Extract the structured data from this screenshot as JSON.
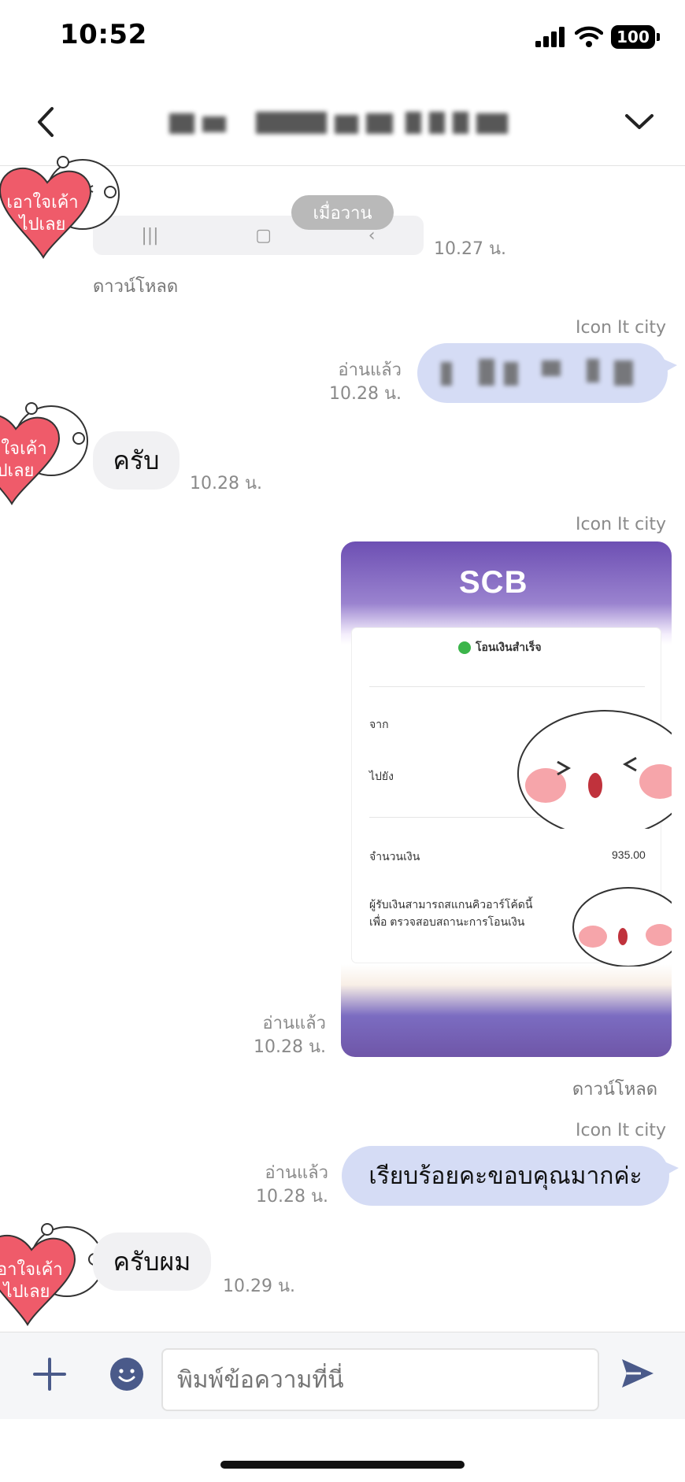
{
  "status_bar": {
    "time": "10:52",
    "battery": "100",
    "signal_icon": "signal-bars-icon",
    "wifi_icon": "wifi-icon"
  },
  "header": {
    "back_icon": "chevron-left-icon",
    "menu_icon": "chevron-down-icon"
  },
  "date_separator": "เมื่อวาน",
  "messages": [
    {
      "id": "m1",
      "direction": "in",
      "type": "sticker",
      "sticker_text": "เอาใจเค้าไปเลย",
      "time": "10.27 น.",
      "download_label": "ดาวน์โหลด"
    },
    {
      "id": "m2",
      "direction": "out",
      "sender": "Icon It city",
      "read": "อ่านแล้ว",
      "time": "10.28 น."
    },
    {
      "id": "m3",
      "direction": "in",
      "text": "ครับ",
      "time": "10.28 น."
    },
    {
      "id": "m4",
      "direction": "out",
      "sender": "Icon It city",
      "type": "image",
      "read": "อ่านแล้ว",
      "time": "10.28 น.",
      "download_label": "ดาวน์โหลด",
      "slip": {
        "bank": "SCB",
        "status": "โอนเงินสำเร็จ",
        "from_label": "จาก",
        "to_label": "ไปยัง",
        "amount_label": "จำนวนเงิน",
        "amount": "935.00",
        "note": "ผู้รับเงินสามารถสแกนคิวอาร์โค้ดนี้เพื่อ ตรวจสอบสถานะการโอนเงิน"
      }
    },
    {
      "id": "m5",
      "direction": "out",
      "sender": "Icon It city",
      "text": "เรียบร้อยคะขอบคุณมากค่ะ",
      "read": "อ่านแล้ว",
      "time": "10.28 น."
    },
    {
      "id": "m6",
      "direction": "in",
      "text": "ครับผม",
      "time": "10.29 น."
    }
  ],
  "input_bar": {
    "placeholder": "พิมพ์ข้อความที่นี่",
    "plus_icon": "plus-icon",
    "emoji_icon": "emoji-icon",
    "send_icon": "send-icon"
  },
  "colors": {
    "outgoing_bubble": "#d5dcf5",
    "incoming_bubble": "#f1f1f3",
    "accent": "#4a5a8a"
  }
}
